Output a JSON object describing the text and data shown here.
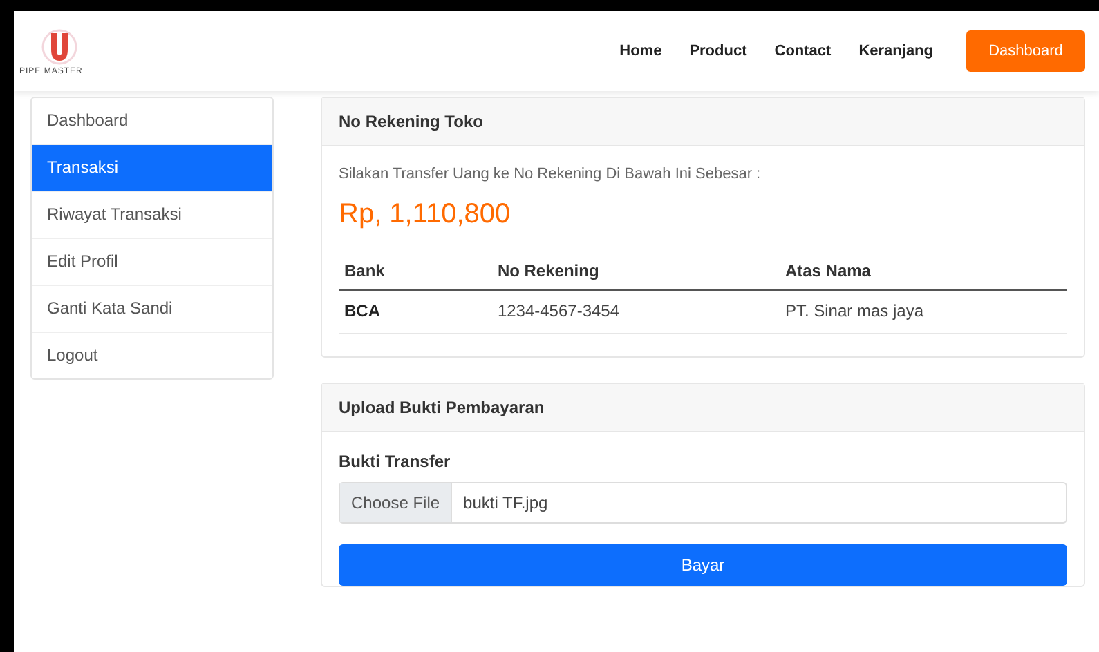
{
  "brand": {
    "name": "PIPE MASTER"
  },
  "nav": {
    "links": [
      "Home",
      "Product",
      "Contact",
      "Keranjang"
    ],
    "button": "Dashboard"
  },
  "sidebar": {
    "items": [
      {
        "label": "Dashboard",
        "selected": false
      },
      {
        "label": "Transaksi",
        "selected": true
      },
      {
        "label": "Riwayat Transaksi",
        "selected": false
      },
      {
        "label": "Edit Profil",
        "selected": false
      },
      {
        "label": "Ganti Kata Sandi",
        "selected": false
      },
      {
        "label": "Logout",
        "selected": false
      }
    ]
  },
  "account_card": {
    "title": "No Rekening Toko",
    "instruction": "Silakan Transfer Uang ke No Rekening Di Bawah Ini Sebesar :",
    "amount": "Rp, 1,110,800",
    "table": {
      "columns": [
        "Bank",
        "No Rekening",
        "Atas Nama"
      ],
      "rows": [
        [
          "BCA",
          "1234-4567-3454",
          "PT. Sinar mas jaya"
        ]
      ]
    }
  },
  "upload_card": {
    "title": "Upload Bukti Pembayaran",
    "label": "Bukti Transfer",
    "choose_button": "Choose File",
    "file_name": "bukti TF.jpg",
    "submit": "Bayar"
  }
}
